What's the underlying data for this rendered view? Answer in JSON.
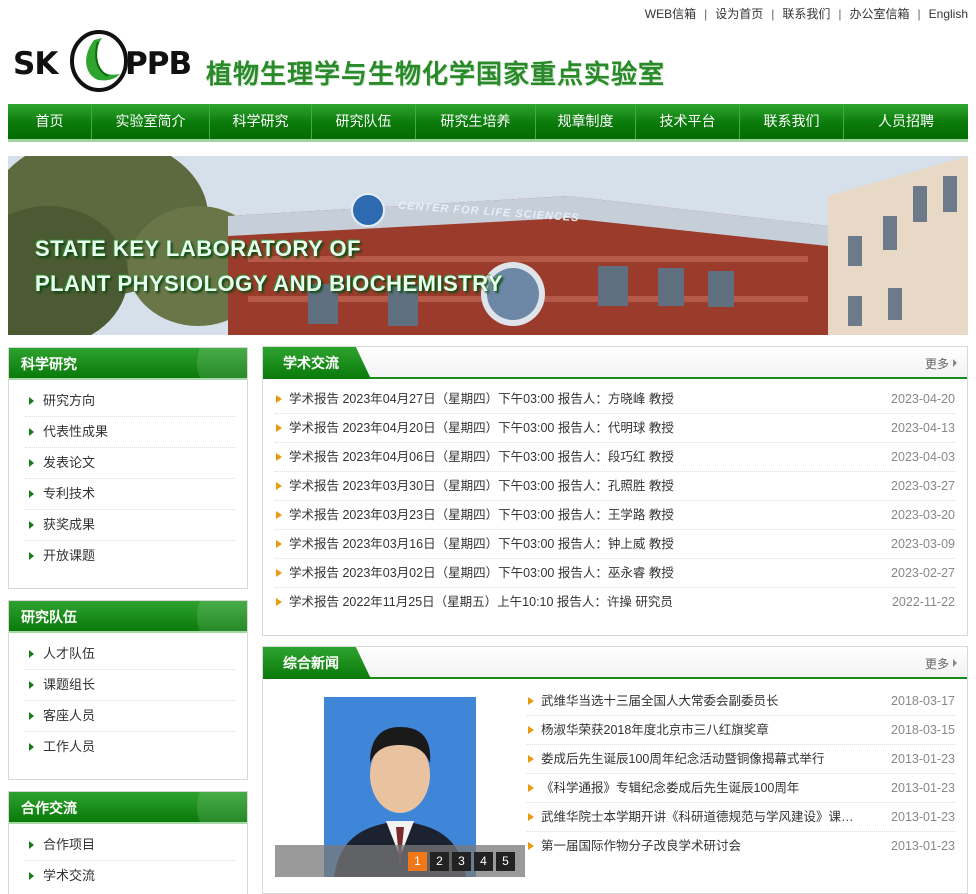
{
  "top_links": [
    "WEB信箱",
    "设为首页",
    "联系我们",
    "办公室信箱",
    "English"
  ],
  "logo": {
    "left": "SK",
    "right": "PPB",
    "title_cn": "植物生理学与生物化学国家重点实验室"
  },
  "nav": [
    {
      "label": "首页",
      "w": 84
    },
    {
      "label": "实验室简介",
      "w": 118
    },
    {
      "label": "科学研究",
      "w": 102
    },
    {
      "label": "研究队伍",
      "w": 104
    },
    {
      "label": "研究生培养",
      "w": 120
    },
    {
      "label": "规章制度",
      "w": 100
    },
    {
      "label": "技术平台",
      "w": 104
    },
    {
      "label": "联系我们",
      "w": 104
    },
    {
      "label": "人员招聘",
      "w": 124
    }
  ],
  "banner": {
    "line1": "STATE KEY LABORATORY OF",
    "line2": "PLANT PHYSIOLOGY AND BIOCHEMISTRY",
    "sign": "CENTER FOR LIFE SCIENCES"
  },
  "sidebar": [
    {
      "title": "科学研究",
      "items": [
        "研究方向",
        "代表性成果",
        "发表论文",
        "专利技术",
        "获奖成果",
        "开放课题"
      ]
    },
    {
      "title": "研究队伍",
      "items": [
        "人才队伍",
        "课题组长",
        "客座人员",
        "工作人员"
      ]
    },
    {
      "title": "合作交流",
      "items": [
        "合作项目",
        "学术交流"
      ]
    }
  ],
  "academic": {
    "title": "学术交流",
    "more": "更多",
    "items": [
      {
        "title": "学术报告 2023年04月27日（星期四）下午03:00 报告人：方晓峰 教授",
        "date": "2023-04-20"
      },
      {
        "title": "学术报告 2023年04月20日（星期四）下午03:00 报告人：代明球 教授",
        "date": "2023-04-13"
      },
      {
        "title": "学术报告 2023年04月06日（星期四）下午03:00 报告人：段巧红 教授",
        "date": "2023-04-03"
      },
      {
        "title": "学术报告 2023年03月30日（星期四）下午03:00 报告人：孔照胜 教授",
        "date": "2023-03-27"
      },
      {
        "title": "学术报告 2023年03月23日（星期四）下午03:00 报告人：王学路 教授",
        "date": "2023-03-20"
      },
      {
        "title": "学术报告 2023年03月16日（星期四）下午03:00 报告人：钟上威 教授",
        "date": "2023-03-09"
      },
      {
        "title": "学术报告 2023年03月02日（星期四）下午03:00 报告人：巫永睿 教授",
        "date": "2023-02-27"
      },
      {
        "title": "学术报告 2022年11月25日（星期五）上午10:10 报告人：许操 研究员",
        "date": "2022-11-22"
      }
    ]
  },
  "news": {
    "title": "综合新闻",
    "more": "更多",
    "pager": [
      "1",
      "2",
      "3",
      "4",
      "5"
    ],
    "active_page": "1",
    "items": [
      {
        "title": "武维华当选十三届全国人大常委会副委员长",
        "date": "2018-03-17"
      },
      {
        "title": "杨淑华荣获2018年度北京市三八红旗奖章",
        "date": "2018-03-15"
      },
      {
        "title": "娄成后先生诞辰100周年纪念活动暨铜像揭幕式举行",
        "date": "2013-01-23"
      },
      {
        "title": "《科学通报》专辑纪念娄成后先生诞辰100周年",
        "date": "2013-01-23"
      },
      {
        "title": "武维华院士本学期开讲《科研道德规范与学风建设》课程...",
        "date": "2013-01-23"
      },
      {
        "title": "第一届国际作物分子改良学术研讨会",
        "date": "2013-01-23"
      }
    ]
  },
  "colors": {
    "brand_green": "#0a7a0a",
    "bullet_orange": "#e89a10",
    "pager_active": "#f07818"
  }
}
